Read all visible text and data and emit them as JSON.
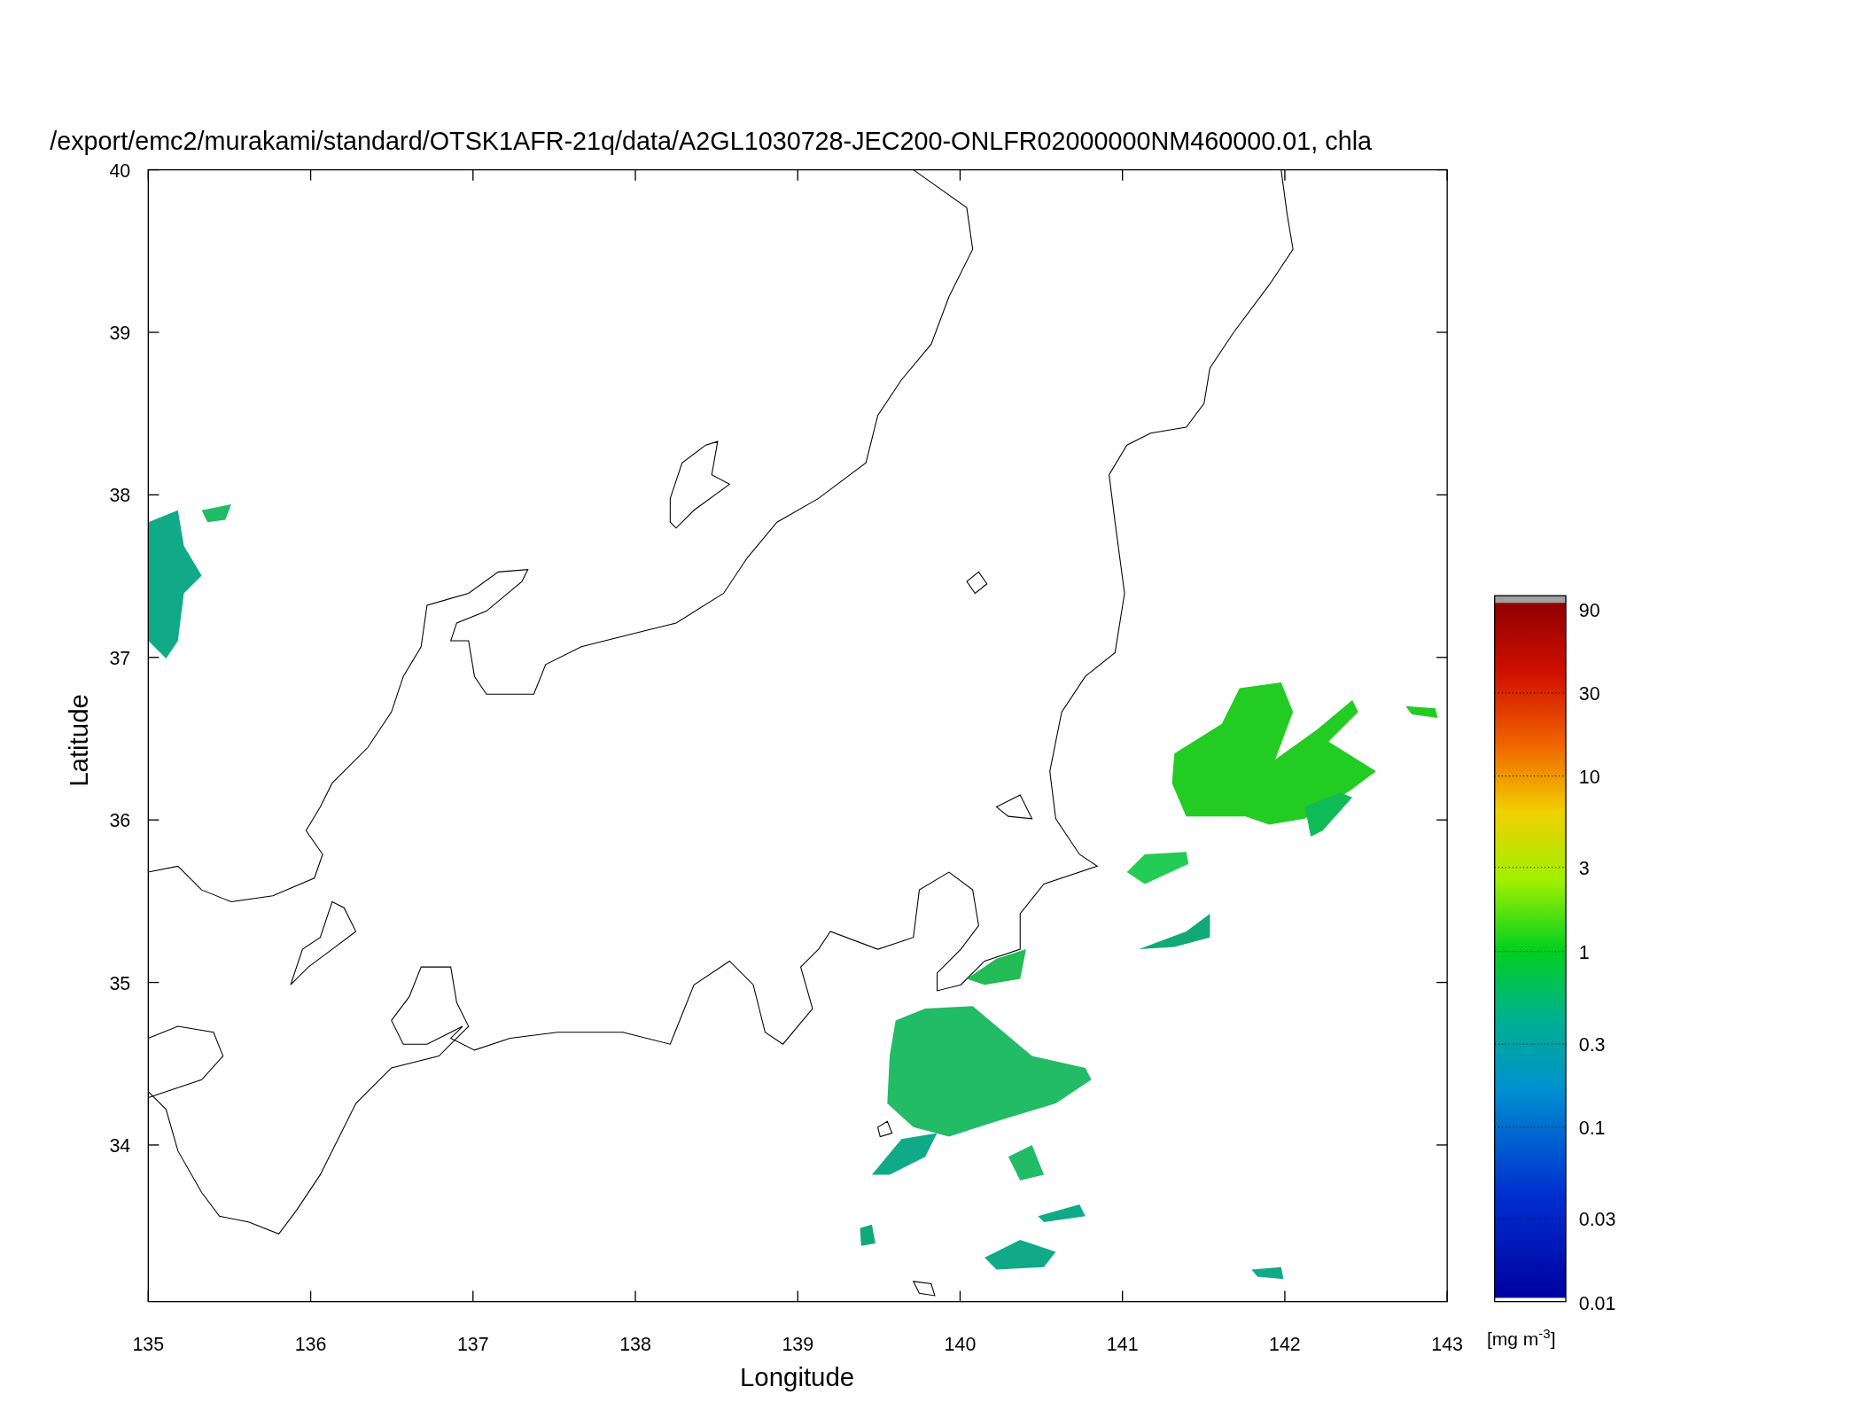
{
  "title": "/export/emc2/murakami/standard/OTSK1AFR-21q/data/A2GL1030728-JEC200-ONLFR02000000NM460000.01, chla",
  "x_axis": {
    "label": "Longitude",
    "ticks": [
      "135",
      "136",
      "137",
      "138",
      "139",
      "140",
      "141",
      "142",
      "143"
    ]
  },
  "y_axis": {
    "label": "Latitude",
    "ticks": [
      "40",
      "39",
      "38",
      "37",
      "36",
      "35",
      "34"
    ]
  },
  "colorbar": {
    "labels": [
      "90",
      "30",
      "10",
      "3",
      "1",
      "0.3",
      "0.1",
      "0.03",
      "0.01"
    ],
    "unit": "[mg m$^{-3}$]"
  }
}
